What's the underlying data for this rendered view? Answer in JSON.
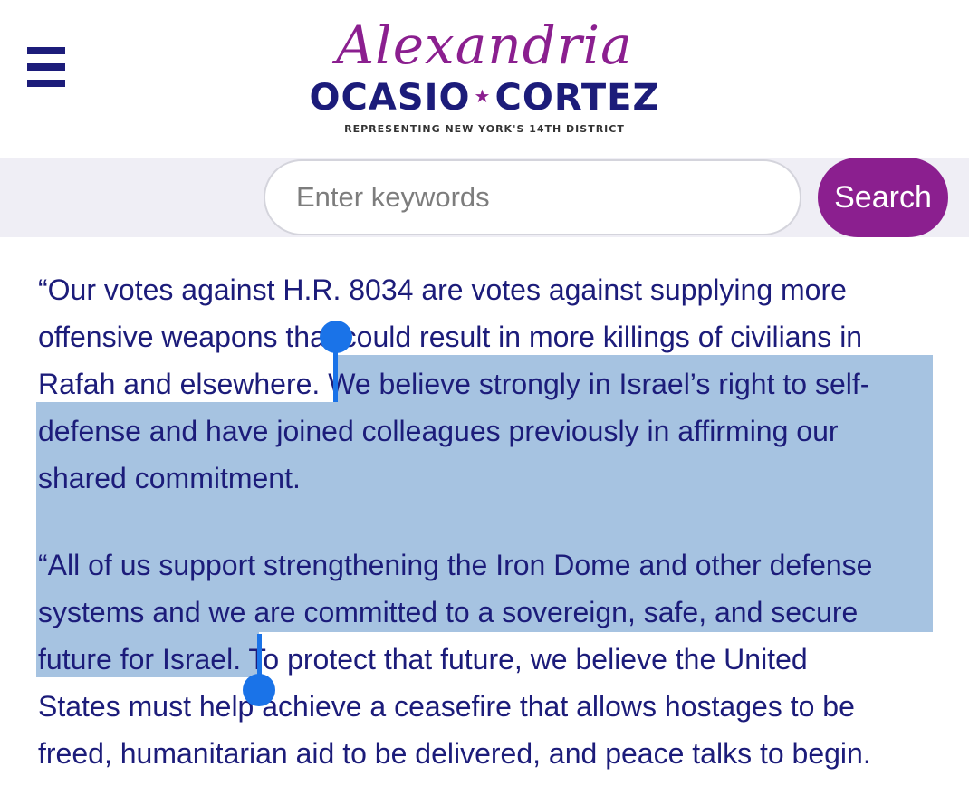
{
  "header": {
    "logo": {
      "script_name": "Alexandria",
      "first_name": "OCASIO",
      "star": "★",
      "last_name": "CORTEZ",
      "tagline": "REPRESENTING NEW YORK'S 14TH DISTRICT"
    },
    "menu_icon": "hamburger-menu-icon"
  },
  "search": {
    "placeholder": "Enter keywords",
    "button_label": "Search"
  },
  "article": {
    "lines": [
      "“Our votes against H.R. 8034 are votes against supplying more",
      "offensive weapons that could result in more killings of civilians in",
      "Rafah and elsewhere. We believe strongly in Israel’s right to self-",
      "defense and have joined colleagues previously in affirming our",
      "shared commitment.",
      "“All of us support strengthening the Iron Dome and other defense",
      "systems and we are committed to a sovereign, safe, and secure",
      "future for Israel. To protect that future, we believe the United",
      "States must help achieve a ceasefire that allows hostages to be",
      "freed, humanitarian aid to be delivered, and peace talks to begin."
    ],
    "selected_text": "We believe strongly in Israel’s right to self-defense and have joined colleagues previously in affirming our shared commitment. “All of us support strengthening the Iron Dome and other defense systems and we are committed to a sovereign, safe, and secure future for Israel."
  },
  "colors": {
    "navy": "#1c1c7a",
    "purple": "#8b1f8f",
    "selection": "#a6c3e1",
    "handle": "#1a73e8",
    "search_band": "#efeef5"
  }
}
